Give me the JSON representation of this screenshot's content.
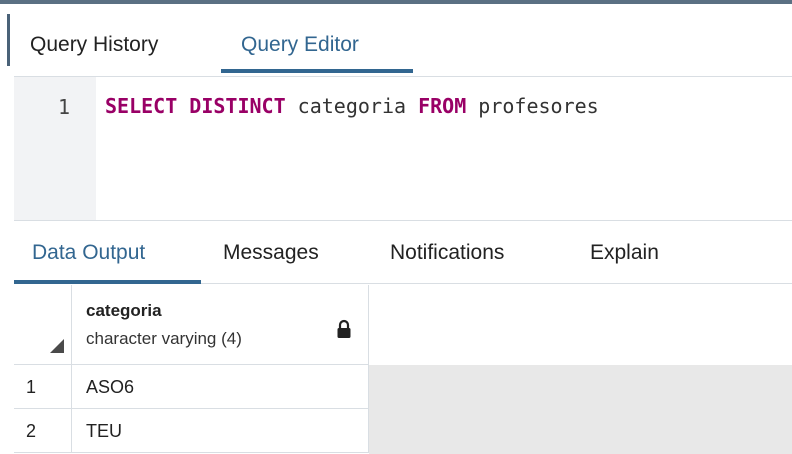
{
  "query_tabs": [
    {
      "label": "Query History",
      "active": false
    },
    {
      "label": "Query Editor",
      "active": true
    }
  ],
  "editor": {
    "line_number": "1",
    "tokens": [
      {
        "text": "SELECT",
        "type": "keyword"
      },
      {
        "text": " ",
        "type": "space"
      },
      {
        "text": "DISTINCT",
        "type": "keyword"
      },
      {
        "text": " categoria ",
        "type": "identifier"
      },
      {
        "text": "FROM",
        "type": "keyword"
      },
      {
        "text": " profesores",
        "type": "identifier"
      }
    ]
  },
  "output_tabs": [
    {
      "label": "Data Output",
      "active": true
    },
    {
      "label": "Messages",
      "active": false
    },
    {
      "label": "Notifications",
      "active": false
    },
    {
      "label": "Explain",
      "active": false
    }
  ],
  "grid": {
    "column": {
      "name": "categoria",
      "type": "character varying (4)"
    },
    "rows": [
      {
        "num": "1",
        "value": "ASO6"
      },
      {
        "num": "2",
        "value": "TEU"
      }
    ]
  },
  "colors": {
    "accent": "#326690",
    "keyword": "#990066",
    "gutter": "#f2f3f5",
    "empty_grid": "#e8e8e8"
  },
  "icons": {
    "lock": "lock-icon",
    "corner": "select-all-triangle-icon"
  }
}
